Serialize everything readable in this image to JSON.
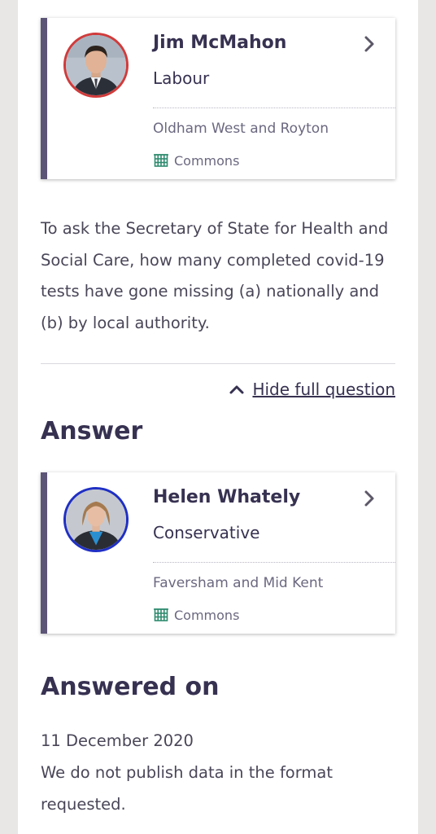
{
  "asker": {
    "name": "Jim McMahon",
    "party": "Labour",
    "constituency": "Oldham West and Royton",
    "house": "Commons",
    "party_color": "#d13b3b"
  },
  "question": {
    "text": "To ask the Secretary of State for Health and Social Care, how many completed covid-19 tests have gone missing (a) nationally and (b) by local authority.",
    "toggle_label": "Hide full question"
  },
  "answer_section": {
    "heading": "Answer"
  },
  "answerer": {
    "name": "Helen Whately",
    "party": "Conservative",
    "constituency": "Faversham and Mid Kent",
    "house": "Commons",
    "party_color": "#1f2fc4"
  },
  "answered_on": {
    "heading": "Answered on",
    "date": "11 December 2020",
    "text": "We do not publish data in the format requested."
  },
  "colors": {
    "card_accent": "#5d5577",
    "commons_green": "#2e8a6e",
    "text_primary": "#373151"
  }
}
